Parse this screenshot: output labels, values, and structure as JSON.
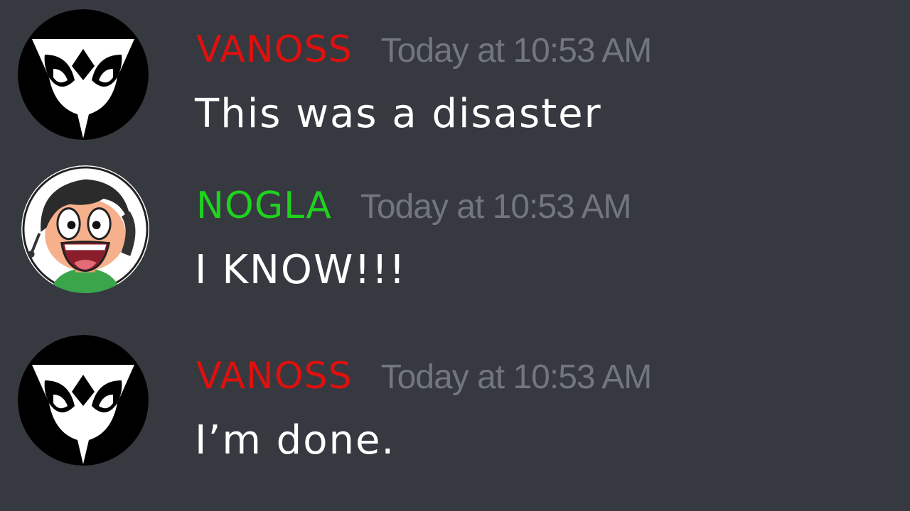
{
  "messages": [
    {
      "author": "VANOSS",
      "author_color": "#e0100e",
      "timestamp": "Today at 10:53 AM",
      "content": "This was a disaster",
      "avatar_icon": "owl-mask-icon"
    },
    {
      "author": "NOGLA",
      "author_color": "#1ed21e",
      "timestamp": "Today at 10:53 AM",
      "content": "I KNOW!!!",
      "avatar_icon": "cartoon-face-icon"
    },
    {
      "author": "VANOSS",
      "author_color": "#e0100e",
      "timestamp": "Today at 10:53 AM",
      "content": "I’m done.",
      "avatar_icon": "owl-mask-icon"
    }
  ],
  "colors": {
    "background": "#36393f",
    "timestamp": "#72767d",
    "message_text": "#ffffff"
  }
}
